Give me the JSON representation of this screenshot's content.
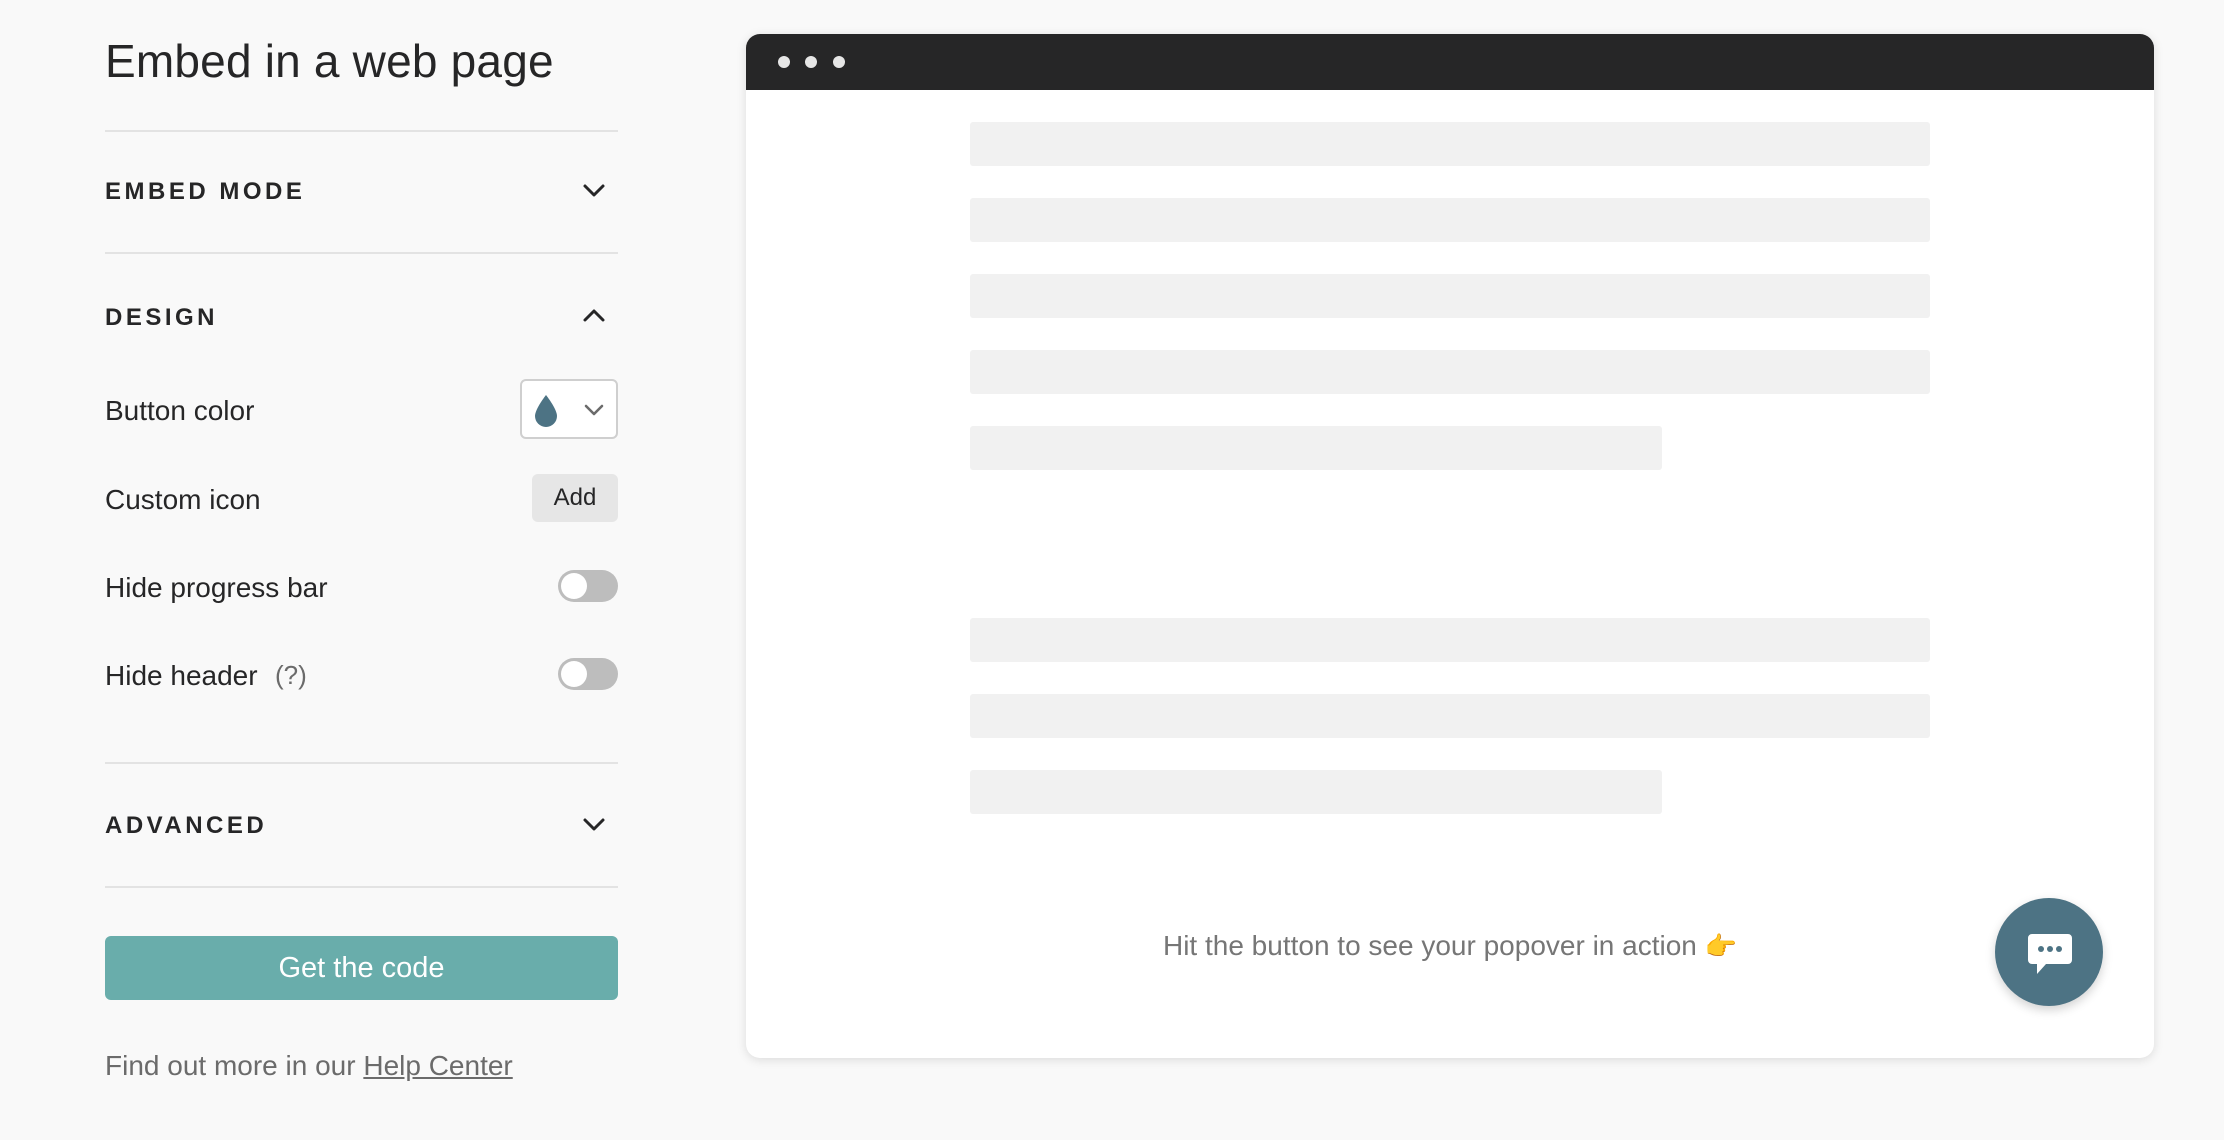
{
  "panel": {
    "title": "Embed in a web page",
    "sections": {
      "embed_mode": {
        "label": "EMBED MODE",
        "expanded": false
      },
      "design": {
        "label": "DESIGN",
        "expanded": true
      },
      "advanced": {
        "label": "ADVANCED",
        "expanded": false
      }
    },
    "design": {
      "button_color": {
        "label": "Button color",
        "value": "#4d7384"
      },
      "custom_icon": {
        "label": "Custom icon",
        "button": "Add"
      },
      "hide_progress_bar": {
        "label": "Hide progress bar",
        "enabled": false
      },
      "hide_header": {
        "label": "Hide header",
        "hint": "(?)",
        "enabled": false
      }
    },
    "cta": {
      "label": "Get the code"
    },
    "help": {
      "prefix": "Find out more in our ",
      "link": "Help Center"
    }
  },
  "preview": {
    "message": "Hit the button to see your popover in action",
    "message_icon": "pointing-right-hand-emoji",
    "chat_button_icon": "chat-bubble-icon"
  },
  "colors": {
    "accent": "#69adab",
    "popover_button": "#4d7384",
    "browser_bar": "#262627",
    "skeleton": "#f1f1f1",
    "toggle_off": "#bdbdbd"
  }
}
